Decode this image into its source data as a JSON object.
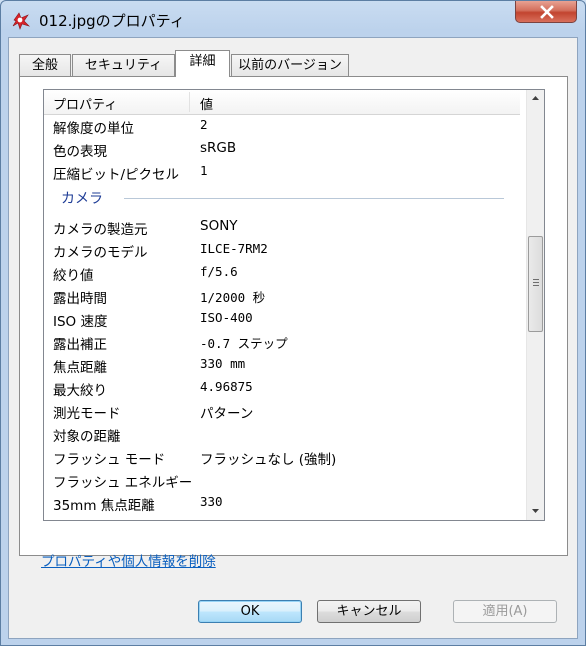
{
  "window": {
    "title": "012.jpgのプロパティ"
  },
  "tabs": [
    {
      "label": "全般"
    },
    {
      "label": "セキュリティ"
    },
    {
      "label": "詳細"
    },
    {
      "label": "以前のバージョン"
    }
  ],
  "list": {
    "header": {
      "property": "プロパティ",
      "value": "値"
    },
    "rows_top": [
      {
        "name": "解像度の単位",
        "value": "2"
      },
      {
        "name": "色の表現",
        "value": "sRGB"
      },
      {
        "name": "圧縮ビット/ピクセル",
        "value": "1"
      }
    ],
    "group_camera": "カメラ",
    "rows_camera": [
      {
        "name": "カメラの製造元",
        "value": "SONY"
      },
      {
        "name": "カメラのモデル",
        "value": "ILCE-7RM2"
      },
      {
        "name": "絞り値",
        "value": "f/5.6"
      },
      {
        "name": "露出時間",
        "value": "1/2000 秒"
      },
      {
        "name": "ISO 速度",
        "value": "ISO-400"
      },
      {
        "name": "露出補正",
        "value": "-0.7 ステップ"
      },
      {
        "name": "焦点距離",
        "value": "330 mm"
      },
      {
        "name": "最大絞り",
        "value": "4.96875"
      },
      {
        "name": "測光モード",
        "value": "パターン"
      },
      {
        "name": "対象の距離",
        "value": ""
      },
      {
        "name": "フラッシュ モード",
        "value": "フラッシュなし (強制)"
      },
      {
        "name": "フラッシュ エネルギー",
        "value": ""
      },
      {
        "name": "35mm 焦点距離",
        "value": "330"
      }
    ]
  },
  "remove_link": "プロパティや個人情報を削除",
  "buttons": {
    "ok": "OK",
    "cancel": "キャンセル",
    "apply": "適用(A)"
  },
  "colors": {
    "group_title": "#1e3c96",
    "link": "#0a5fbf",
    "close_button": "#c2442f"
  }
}
